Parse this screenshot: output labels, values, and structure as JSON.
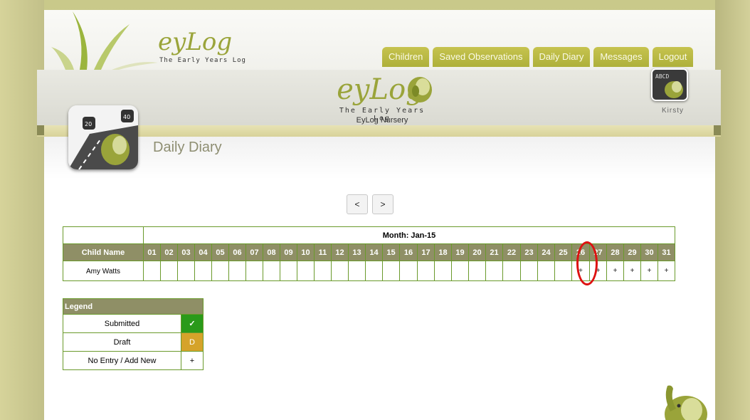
{
  "header": {
    "logo_text": "eyLog",
    "logo_subtitle": "The Early Years Log",
    "nursery_name": "EyLog Nursery",
    "user_name": "Kirsty",
    "tabs": [
      "Children",
      "Saved Observations",
      "Daily Diary",
      "Messages",
      "Logout"
    ]
  },
  "page": {
    "title": "Daily Diary",
    "prev_label": "<",
    "next_label": ">"
  },
  "diary": {
    "month_label": "Month: Jan-15",
    "child_name_header": "Child Name",
    "days": [
      "01",
      "02",
      "03",
      "04",
      "05",
      "06",
      "07",
      "08",
      "09",
      "10",
      "11",
      "12",
      "13",
      "14",
      "15",
      "16",
      "17",
      "18",
      "19",
      "20",
      "21",
      "22",
      "23",
      "24",
      "25",
      "26",
      "27",
      "28",
      "29",
      "30",
      "31"
    ],
    "rows": [
      {
        "child": "Amy Watts",
        "cells": [
          "",
          "",
          "",
          "",
          "",
          "",
          "",
          "",
          "",
          "",
          "",
          "",
          "",
          "",
          "",
          "",
          "",
          "",
          "",
          "",
          "",
          "",
          "",
          "",
          "",
          "+",
          "+",
          "+",
          "+",
          "+",
          "+"
        ]
      }
    ],
    "highlighted_day": "26",
    "highlight_color": "#dd1111"
  },
  "legend": {
    "title": "Legend",
    "items": [
      {
        "label": "Submitted",
        "symbol": "✓",
        "color": "#2a9a1a"
      },
      {
        "label": "Draft",
        "symbol": "D",
        "color": "#d5a32a"
      },
      {
        "label": "No Entry / Add New",
        "symbol": "+",
        "color": "#ffffff"
      }
    ]
  },
  "colors": {
    "accent": "#aeb03b",
    "header_bg": "#8f8f66",
    "grid_border": "#6a9a2b"
  }
}
